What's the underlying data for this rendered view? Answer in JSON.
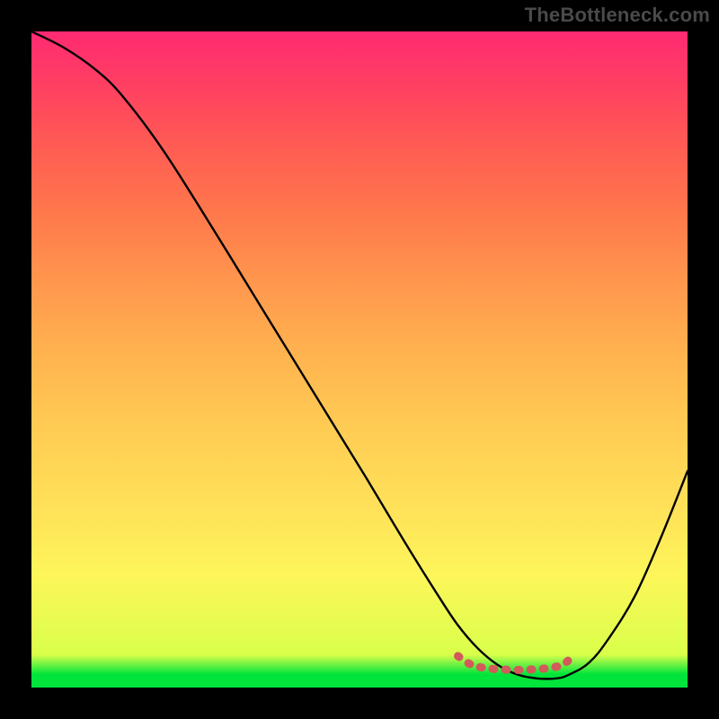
{
  "watermark": "TheBottleneck.com",
  "chart_data": {
    "type": "line",
    "title": "",
    "xlabel": "",
    "ylabel": "",
    "xlim": [
      0,
      100
    ],
    "ylim": [
      0,
      100
    ],
    "grid": false,
    "legend": false,
    "series": [
      {
        "name": "bottleneck-curve",
        "x": [
          0,
          5,
          10,
          14,
          20,
          27,
          35,
          43,
          51,
          57,
          62,
          65,
          68,
          71,
          74,
          77,
          80,
          82,
          85,
          88,
          92,
          96,
          100
        ],
        "values": [
          100,
          97.5,
          94,
          90,
          82,
          71,
          58,
          45,
          32,
          22,
          14,
          9.5,
          6,
          3.5,
          2,
          1.4,
          1.4,
          2,
          3.8,
          7.5,
          14,
          23,
          33
        ],
        "color": "#000000"
      },
      {
        "name": "optimal-zone-marker",
        "x": [
          65,
          67,
          69,
          71,
          73,
          75,
          77,
          79,
          81,
          82.5
        ],
        "values": [
          4.8,
          3.5,
          3.0,
          2.8,
          2.7,
          2.7,
          2.8,
          3.0,
          3.5,
          4.8
        ],
        "color": "#d35a5a"
      }
    ],
    "annotations": []
  },
  "background_gradient": {
    "stops": [
      {
        "pos": 0.0,
        "color": "#00e43b"
      },
      {
        "pos": 0.02,
        "color": "#00e43b"
      },
      {
        "pos": 0.05,
        "color": "#d9ff4a"
      },
      {
        "pos": 0.17,
        "color": "#fdf65a"
      },
      {
        "pos": 0.4,
        "color": "#ffcb53"
      },
      {
        "pos": 0.63,
        "color": "#ff934d"
      },
      {
        "pos": 0.83,
        "color": "#ff5a54"
      },
      {
        "pos": 1.0,
        "color": "#ff2a72"
      }
    ]
  }
}
